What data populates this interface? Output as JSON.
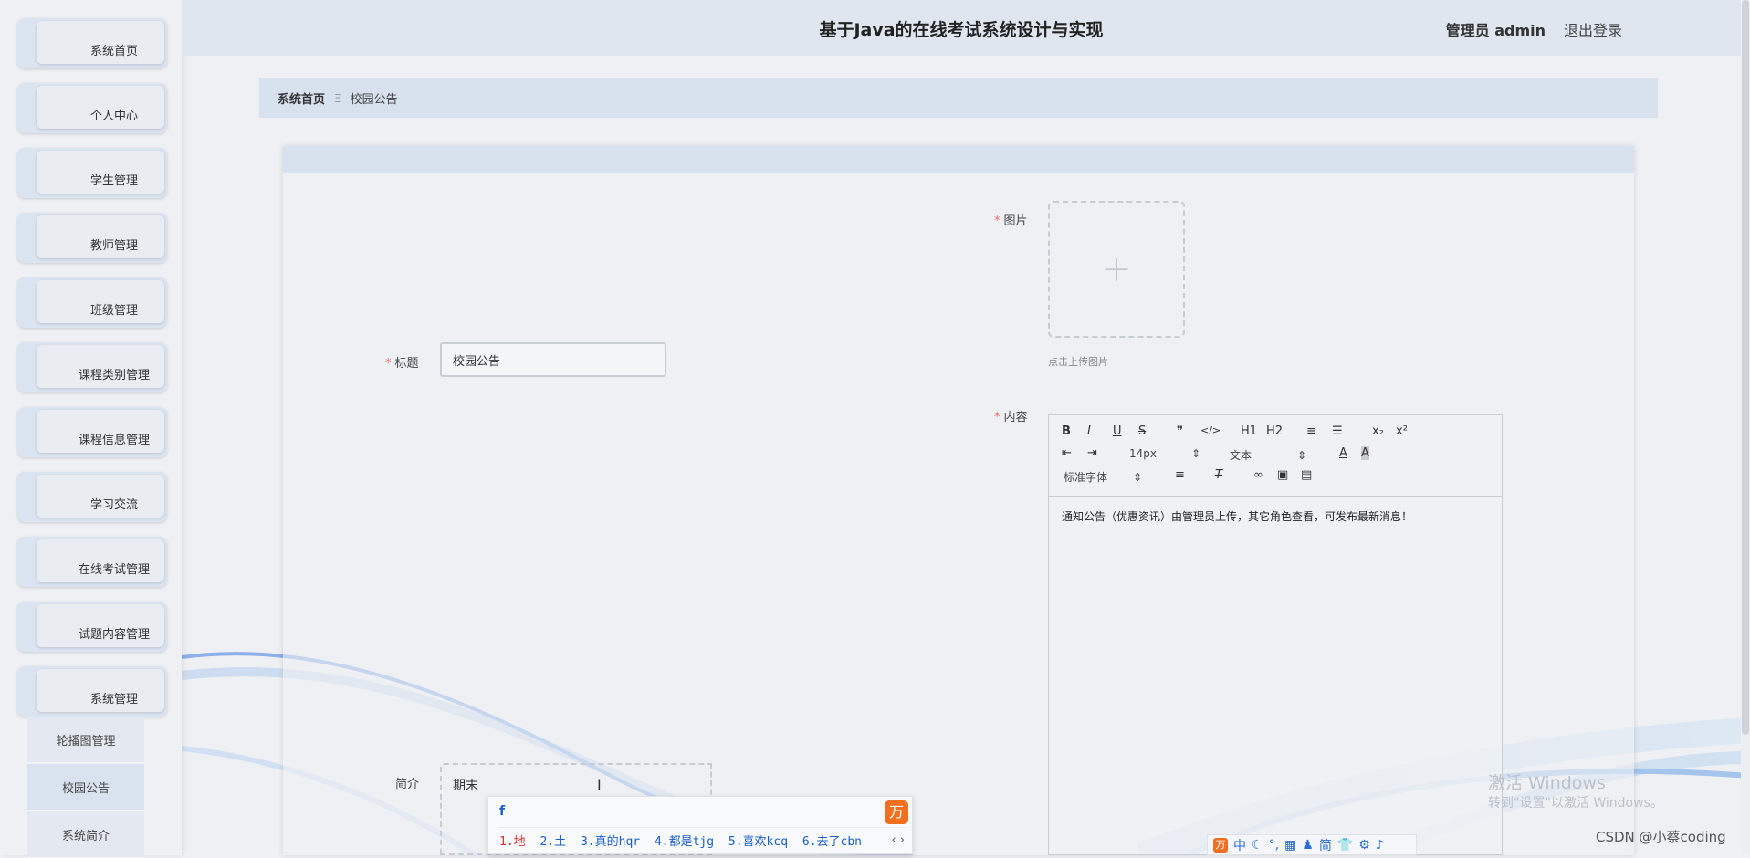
{
  "header": {
    "title": "基于Java的在线考试系统设计与实现",
    "user": "管理员 admin",
    "logout": "退出登录"
  },
  "sidebar": {
    "items": [
      {
        "label": "系统首页"
      },
      {
        "label": "个人中心"
      },
      {
        "label": "学生管理"
      },
      {
        "label": "教师管理"
      },
      {
        "label": "班级管理"
      },
      {
        "label": "课程类别管理"
      },
      {
        "label": "课程信息管理"
      },
      {
        "label": "学习交流"
      },
      {
        "label": "在线考试管理"
      },
      {
        "label": "试题内容管理"
      },
      {
        "label": "系统管理"
      }
    ],
    "subitems": [
      {
        "label": "轮播图管理"
      },
      {
        "label": "校园公告"
      },
      {
        "label": "系统简介"
      }
    ]
  },
  "breadcrumb": {
    "home": "系统首页",
    "separator": "Ξ",
    "current": "校园公告"
  },
  "form": {
    "title_label": "标题",
    "title_value": "校园公告",
    "image_label": "图片",
    "upload_hint": "点击上传图片",
    "content_label": "内容",
    "content_text": "通知公告（优惠资讯）由管理员上传，其它角色查看，可发布最新消息！",
    "brief_label": "简介",
    "brief_value": "期末",
    "required_mark": "*"
  },
  "editor": {
    "row1": [
      "B",
      "I",
      "U",
      "S",
      "❞",
      "</>",
      "H1",
      "H2",
      "≡",
      "☰",
      "x₂",
      "x²"
    ],
    "size_select": "14px",
    "type_select": "文本",
    "font_select": "标准字体",
    "text_color_icon": "A",
    "bg_color_icon": "A"
  },
  "ime": {
    "input": "f",
    "candidates": [
      "1.地",
      "2.土",
      "3.真的hqr",
      "4.都是tjg",
      "5.喜欢kcq",
      "6.去了cbn"
    ],
    "nav": "‹ ›",
    "logo": "万"
  },
  "imebar": {
    "logo": "万",
    "items": [
      "中",
      "☾",
      "°,",
      "▦",
      "♟",
      "简",
      "👕",
      "⚙",
      "♪"
    ]
  },
  "watermark": {
    "line1": "激活 Windows",
    "line2": "转到\"设置\"以激活 Windows。"
  },
  "csdn": "CSDN @小蔡coding",
  "colors": {
    "accent_bg": "#d8e1ee",
    "required": "#f56c6c",
    "ime_brand": "#f26f21",
    "ime_text": "#1a5fc7"
  }
}
